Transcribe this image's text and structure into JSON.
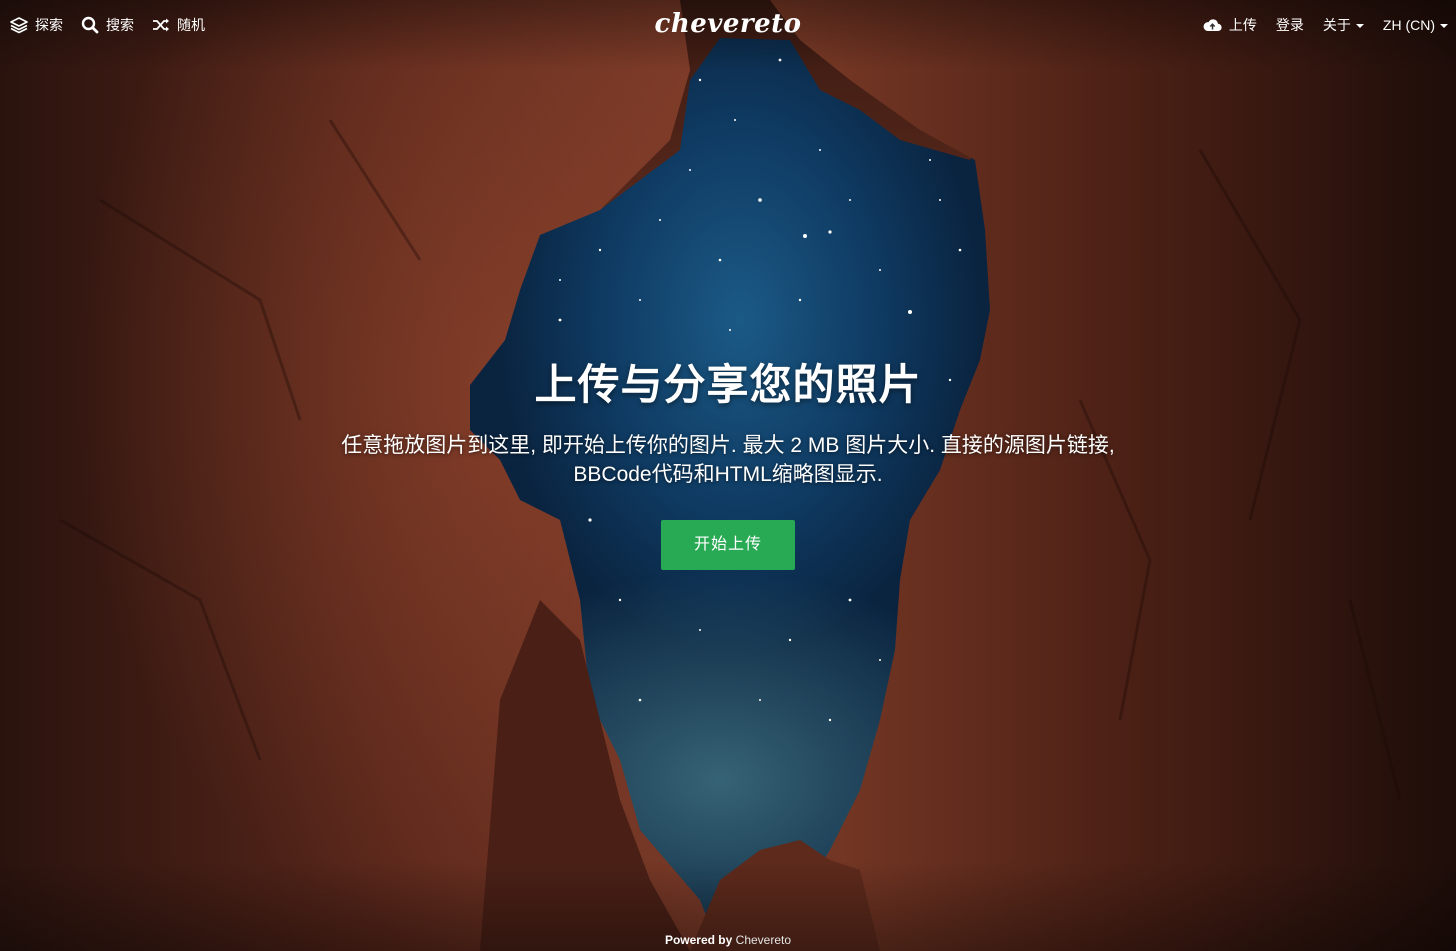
{
  "nav": {
    "left": [
      {
        "label": "探索",
        "icon": "layers-icon"
      },
      {
        "label": "搜索",
        "icon": "search-icon"
      },
      {
        "label": "随机",
        "icon": "shuffle-icon"
      }
    ],
    "logo": "chevereto",
    "right": {
      "upload": {
        "label": "上传",
        "icon": "cloud-upload-icon"
      },
      "login": "登录",
      "about": "关于",
      "language": "ZH (CN)"
    }
  },
  "hero": {
    "title": "上传与分享您的照片",
    "description": "任意拖放图片到这里, 即开始上传你的图片. 最大 2 MB 图片大小. 直接的源图片链接, BBCode代码和HTML缩略图显示.",
    "cta_label": "开始上传"
  },
  "footer": {
    "prefix": "Powered by",
    "brand": "Chevereto"
  },
  "colors": {
    "cta": "#28a954",
    "sky": "#0f3b63",
    "rock": "#6b2f22"
  }
}
